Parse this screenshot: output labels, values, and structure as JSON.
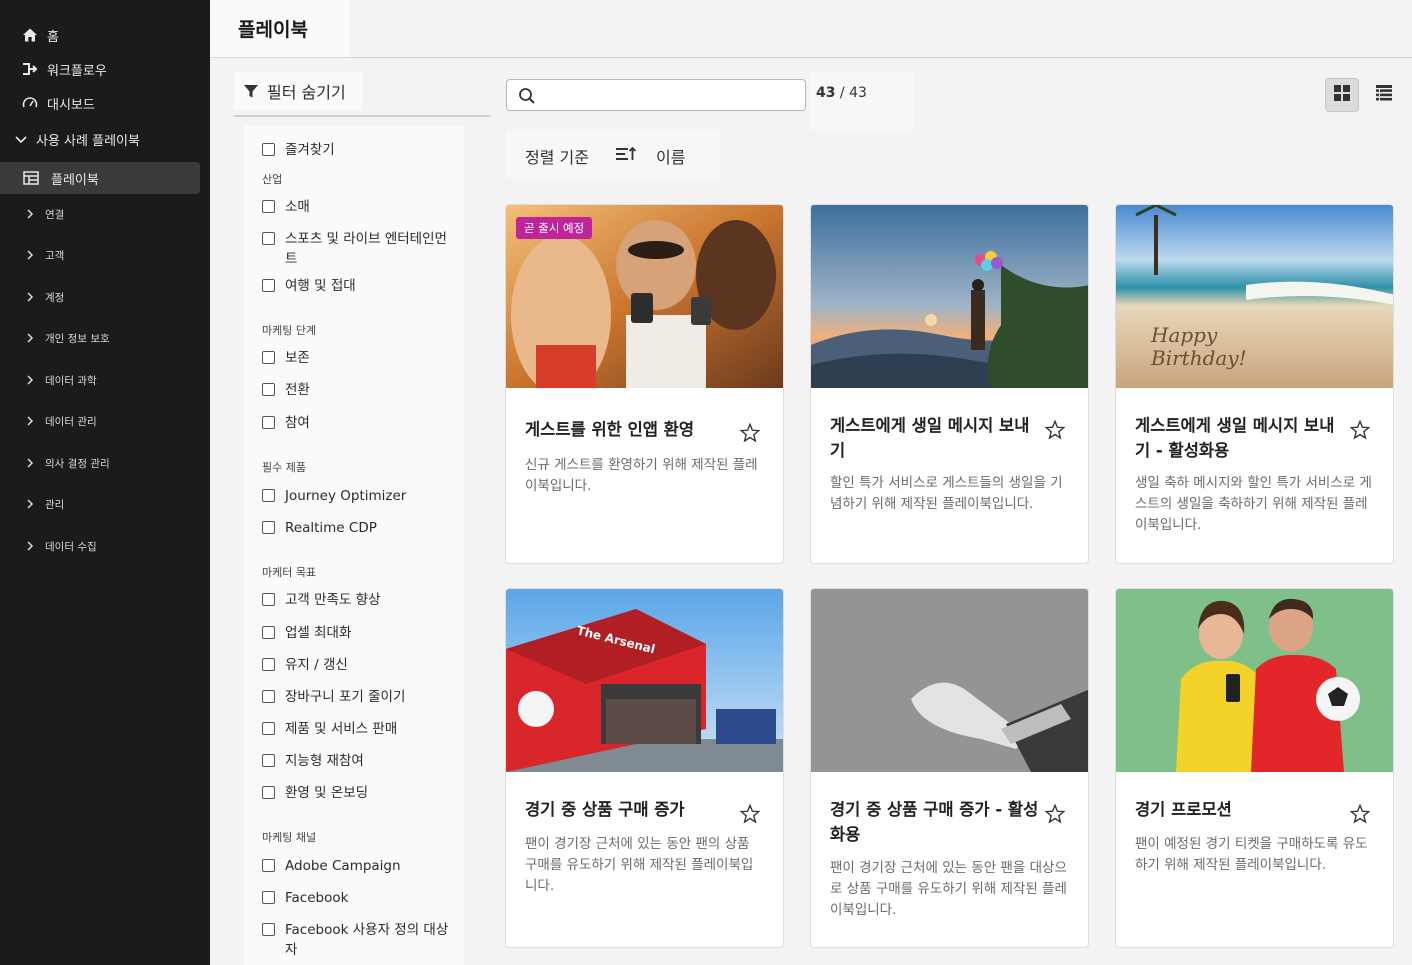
{
  "nav": {
    "home": "홈",
    "workflow": "워크플로우",
    "dashboard": "대시보드",
    "usecase": "사용 사례 플레이북",
    "playbook": "플레이북",
    "sub": [
      "연결",
      "고객",
      "계정",
      "개인 정보 보호",
      "데이터 과학",
      "데이터 관리",
      "의사 결정 관리",
      "관리",
      "데이터 수집"
    ]
  },
  "header": {
    "title": "플레이북"
  },
  "filter": {
    "toggle": "필터 숨기기",
    "favorites": "즐겨찾기",
    "sections": [
      {
        "title": "산업",
        "items": [
          "소매",
          "스포츠 및 라이브 엔터테인먼트",
          "여행 및 접대"
        ]
      },
      {
        "title": "마케팅 단계",
        "items": [
          "보존",
          "전환",
          "참여"
        ]
      },
      {
        "title": "필수 제품",
        "items": [
          "Journey Optimizer",
          "Realtime CDP"
        ]
      },
      {
        "title": "마케터 목표",
        "items": [
          "고객 만족도 향상",
          "업셀 최대화",
          "유지 / 갱신",
          "장바구니 포기 줄이기",
          "제품 및 서비스 판매",
          "지능형 재참여",
          "환영 및 온보딩"
        ]
      },
      {
        "title": "마케팅 채널",
        "items": [
          "Adobe Campaign",
          "Facebook",
          "Facebook 사용자 정의 대상자"
        ]
      }
    ]
  },
  "toolbar": {
    "search_value": "",
    "count_shown": "43",
    "count_sep": " / ",
    "count_total": "43",
    "sort_label": "정렬 기준",
    "sort_value": "이름"
  },
  "cards": [
    {
      "badge": "곧 출시 예정",
      "title": "게스트를 위한 인앱 환영",
      "desc": "신규 게스트를 환영하기 위해 제작된 플레이북입니다."
    },
    {
      "title": "게스트에게 생일 메시지 보내기",
      "desc": "할인 특가 서비스로 게스트들의 생일을 기념하기 위해 제작된 플레이북입니다."
    },
    {
      "title": "게스트에게 생일 메시지 보내기 - 활성화용",
      "desc": "생일 축하 메시지와 할인 특가 서비스로 게스트의 생일을 축하하기 위해 제작된 플레이북입니다."
    },
    {
      "title": "경기 중 상품 구매 증가",
      "desc": "팬이 경기장 근처에 있는 동안 팬의 상품 구매를 유도하기 위해 제작된 플레이북입니다."
    },
    {
      "title": "경기 중 상품 구매 증가 - 활성화용",
      "desc": "팬이 경기장 근처에 있는 동안 팬을 대상으로 상품 구매를 유도하기 위해 제작된 플레이북입니다."
    },
    {
      "title": "경기 프로모션",
      "desc": "팬이 예정된 경기 티켓을 구매하도록 유도하기 위해 제작된 플레이북입니다."
    }
  ],
  "card_image_text": {
    "stand": "The Arsenal",
    "sand": [
      "Happy",
      "Birthday!"
    ]
  },
  "icons": [
    "home-icon",
    "workflow-icon",
    "dashboard-icon",
    "chevron-down-icon",
    "table-icon",
    "chevron-right-icon",
    "filter-icon",
    "search-icon",
    "sort-icon",
    "grid-view-icon",
    "list-view-icon",
    "star-icon"
  ],
  "colors": {
    "sidebar": "#1b1b1b",
    "badge": "#c0239a",
    "accent_text": "#222222"
  }
}
